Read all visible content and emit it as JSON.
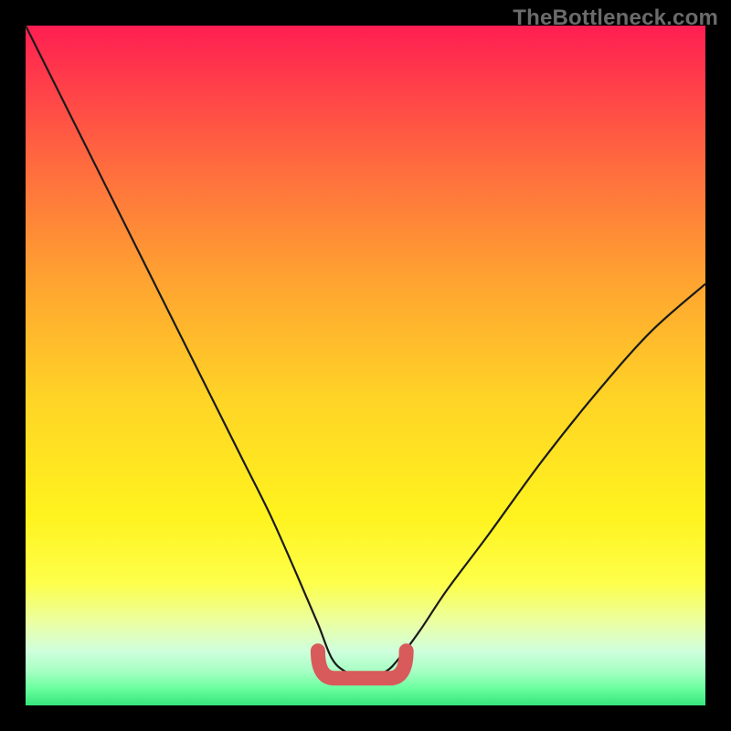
{
  "watermark": "TheBottleneck.com",
  "chart_data": {
    "type": "line",
    "title": "",
    "xlabel": "",
    "ylabel": "",
    "xlim": [
      0,
      100
    ],
    "ylim": [
      0,
      100
    ],
    "grid": false,
    "legend": false,
    "note": "Single black curve (bottleneck / mismatch %) plotted over a vertical heat gradient from red (top, bad) to green (bottom, good). A short pink-red rounded segment marks the flat minimum region near the bottom.",
    "series": [
      {
        "name": "bottleneck-curve",
        "x": [
          0,
          4,
          8,
          12,
          16,
          20,
          24,
          28,
          32,
          36,
          40,
          43,
          45,
          47,
          50,
          53,
          55,
          58,
          62,
          68,
          76,
          84,
          92,
          100
        ],
        "y": [
          100,
          92,
          84,
          76,
          68,
          60,
          52,
          44,
          36,
          28,
          19,
          12,
          7,
          5,
          4,
          5,
          7,
          11,
          17,
          25,
          36,
          46,
          55,
          62
        ]
      }
    ],
    "highlight_region": {
      "x_start": 43,
      "x_end": 56,
      "y": 4
    },
    "background_gradient_stops": [
      {
        "pos": 0,
        "color": "#ff1e52"
      },
      {
        "pos": 20,
        "color": "#ff693f"
      },
      {
        "pos": 55,
        "color": "#ffd426"
      },
      {
        "pos": 82,
        "color": "#fdff4a"
      },
      {
        "pos": 100,
        "color": "#36e57a"
      }
    ]
  }
}
